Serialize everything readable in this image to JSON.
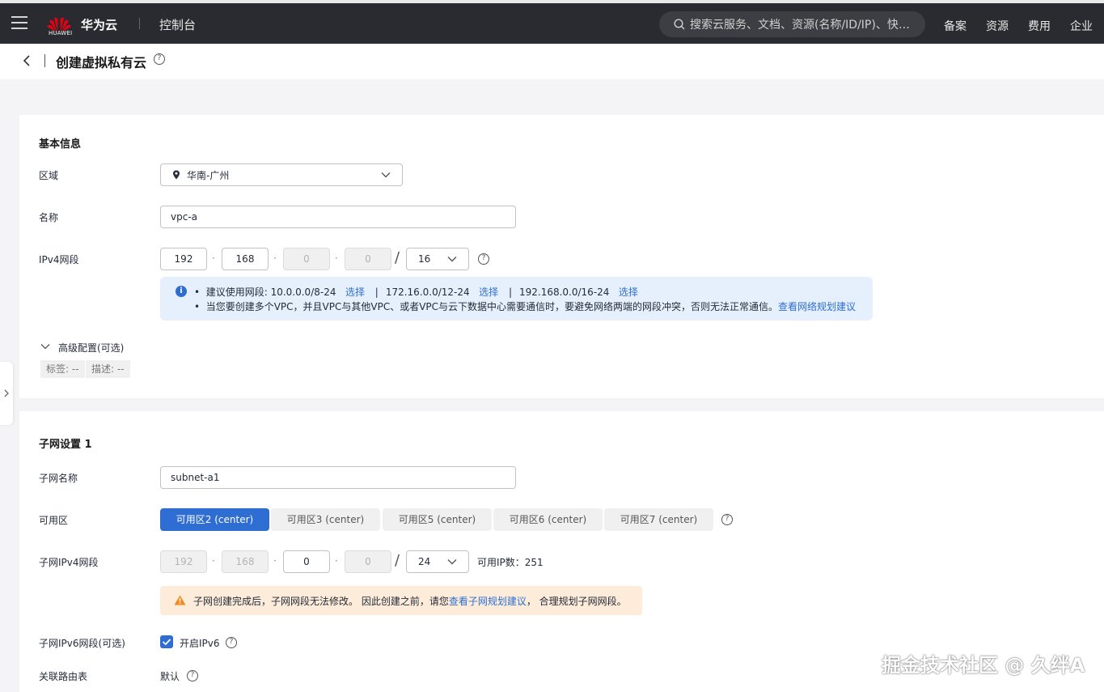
{
  "topbar": {
    "logo_text": "HUAWEI",
    "brand": "华为云",
    "console": "控制台",
    "search_placeholder": "搜索云服务、文档、资源(名称/ID/IP)、快捷...",
    "nav": [
      "备案",
      "资源",
      "费用",
      "企业"
    ]
  },
  "page": {
    "title": "创建虚拟私有云"
  },
  "basic": {
    "section_title": "基本信息",
    "region_label": "区域",
    "region_value": "华南-广州",
    "name_label": "名称",
    "name_value": "vpc-a",
    "ipv4_label": "IPv4网段",
    "ip": [
      "192",
      "168",
      "0",
      "0"
    ],
    "mask": "16",
    "tip_line1_prefix": "建议使用网段: 10.0.0.0/8-24",
    "tip_select": "选择",
    "tip_seg2": "172.16.0.0/12-24",
    "tip_seg3": "192.168.0.0/16-24",
    "tip_line2": "当您要创建多个VPC，并且VPC与其他VPC、或者VPC与云下数据中心需要通信时，要避免网络两端的网段冲突，否则无法正常通信。",
    "tip_line2_link": "查看网络规划建议",
    "advanced_label": "高级配置(可选)",
    "tag_label": "标签: --",
    "desc_label": "描述: --"
  },
  "subnet": {
    "section_title": "子网设置 1",
    "name_label": "子网名称",
    "name_value": "subnet-a1",
    "az_label": "可用区",
    "az_options": [
      "可用区2 (center)",
      "可用区3 (center)",
      "可用区5 (center)",
      "可用区6 (center)",
      "可用区7 (center)"
    ],
    "ipv4_label": "子网IPv4网段",
    "ip": [
      "192",
      "168",
      "0",
      "0"
    ],
    "mask": "24",
    "available_ip": "可用IP数：251",
    "warn_prefix": "子网创建完成后，子网网段无法修改。 因此创建之前，请您",
    "warn_link": "查看子网规划建议",
    "warn_suffix": "， 合理规划子网网段。",
    "ipv6_label": "子网IPv6网段(可选)",
    "ipv6_check_label": "开启IPv6",
    "route_label": "关联路由表",
    "route_value": "默认"
  },
  "watermark": "掘金技术社区 @ 久绊A",
  "colors": {
    "primary": "#2e6ed3",
    "topbar": "#2a2b30",
    "info_bg": "#e6f0fd",
    "warn_bg": "#fdecd9",
    "warn_icon": "#f08a24"
  }
}
